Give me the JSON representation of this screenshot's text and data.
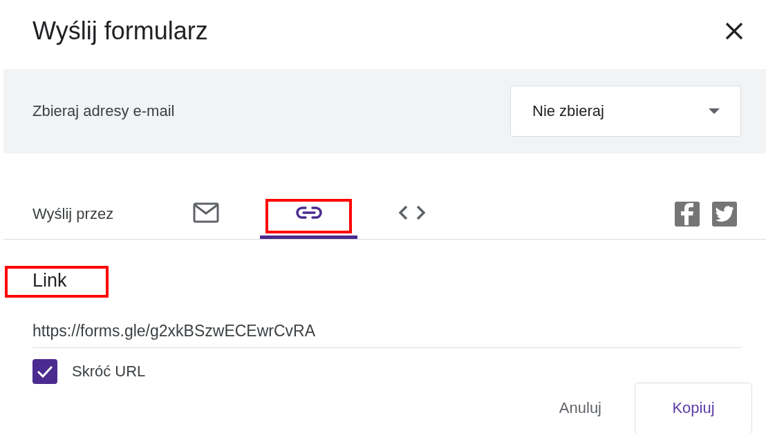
{
  "dialog": {
    "title": "Wyślij formularz"
  },
  "email_collection": {
    "label": "Zbieraj adresy e-mail",
    "value": "Nie zbieraj"
  },
  "send_via": {
    "label": "Wyślij przez",
    "tabs": [
      {
        "kind": "email",
        "selected": false,
        "highlighted": false
      },
      {
        "kind": "link",
        "selected": true,
        "highlighted": true
      },
      {
        "kind": "embed",
        "selected": false,
        "highlighted": false
      }
    ],
    "share": [
      {
        "kind": "facebook"
      },
      {
        "kind": "twitter"
      }
    ]
  },
  "link": {
    "heading": "Link",
    "heading_highlighted": true,
    "url": "https://forms.gle/g2xkBSzwECEwrCvRA",
    "shorten": {
      "label": "Skróć URL",
      "checked": true
    }
  },
  "buttons": [
    {
      "label": "Anuluj",
      "kind": "text"
    },
    {
      "label": "Kopiuj",
      "kind": "outlined"
    }
  ]
}
